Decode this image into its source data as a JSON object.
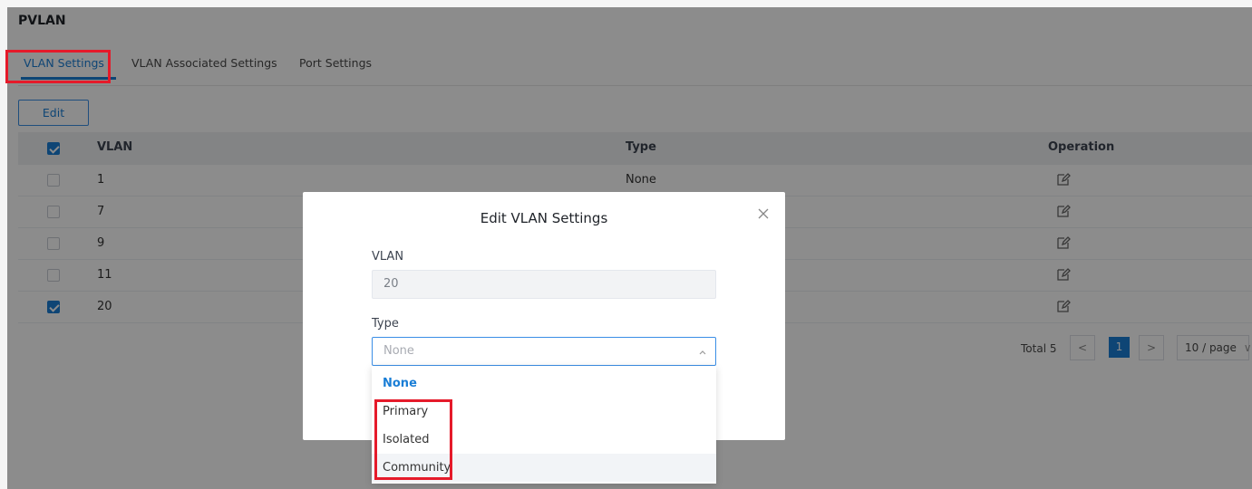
{
  "page": {
    "title": "PVLAN"
  },
  "tabs": [
    {
      "label": "VLAN Settings",
      "active": true
    },
    {
      "label": "VLAN Associated Settings",
      "active": false
    },
    {
      "label": "Port Settings",
      "active": false
    }
  ],
  "toolbar": {
    "edit_label": "Edit"
  },
  "table": {
    "headers": {
      "vlan": "VLAN",
      "type": "Type",
      "operation": "Operation"
    },
    "header_checked": true,
    "rows": [
      {
        "vlan": "1",
        "type": "None",
        "checked": false
      },
      {
        "vlan": "7",
        "type": "",
        "checked": false
      },
      {
        "vlan": "9",
        "type": "",
        "checked": false
      },
      {
        "vlan": "11",
        "type": "",
        "checked": false
      },
      {
        "vlan": "20",
        "type": "",
        "checked": true
      }
    ]
  },
  "pagination": {
    "total": "Total 5",
    "prev": "<",
    "current": "1",
    "next": ">",
    "page_size": "10 / page"
  },
  "dialog": {
    "title": "Edit VLAN Settings",
    "vlan_label": "VLAN",
    "vlan_value": "20",
    "type_label": "Type",
    "type_placeholder": "None",
    "options": [
      "None",
      "Primary",
      "Isolated",
      "Community"
    ],
    "selected_option": "None"
  },
  "colors": {
    "accent": "#1a7ed6",
    "highlight": "#e51a2a"
  },
  "icons": {
    "close": "close-icon",
    "edit": "edit-icon",
    "chevron": "chevron-up-icon"
  }
}
